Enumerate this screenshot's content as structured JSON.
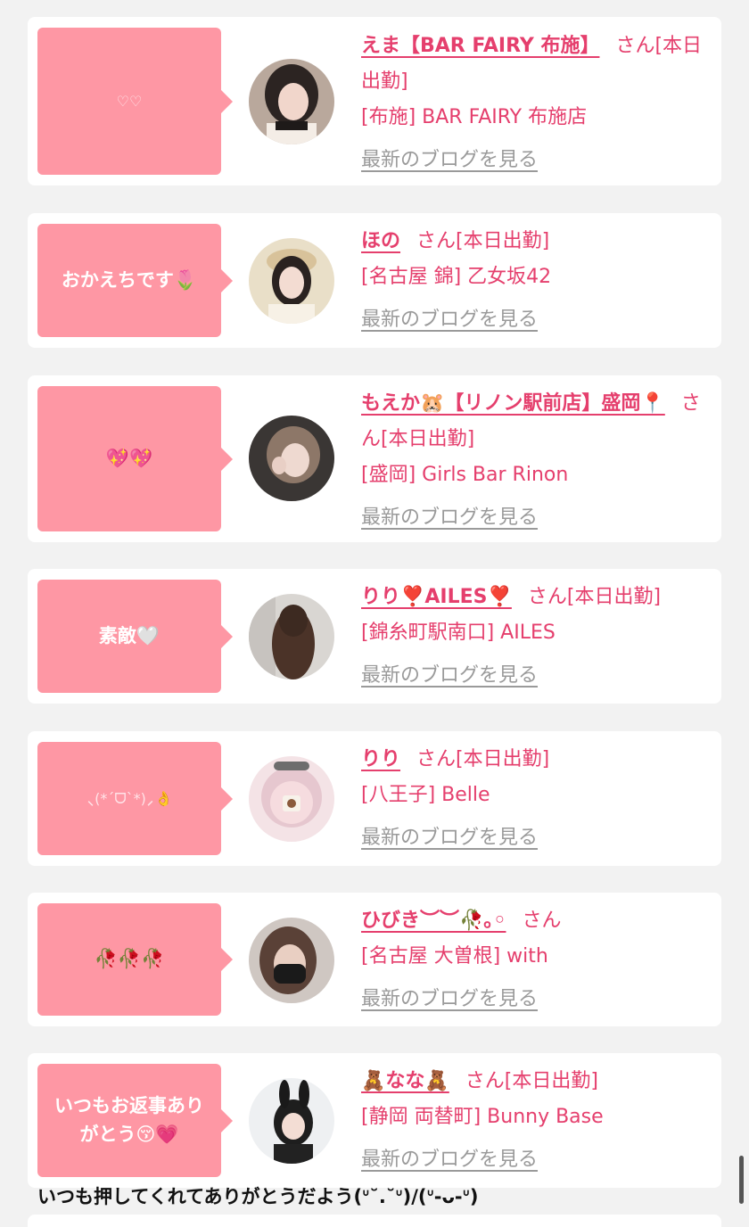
{
  "entries": [
    {
      "comment": "♡♡",
      "name": "えま【BAR FAIRY 布施】",
      "san": "さん[本日出勤]",
      "shop": "[布施] BAR FAIRY 布施店",
      "blog_link": "最新のブログを見る"
    },
    {
      "comment": "おかえちです🌷",
      "name": "ほの",
      "san": "さん[本日出勤]",
      "shop": "[名古屋 錦] 乙女坂42",
      "blog_link": "最新のブログを見る"
    },
    {
      "comment": "💖💖",
      "name": "もえか🐹【リノン駅前店】盛岡📍",
      "san": "さん[本日出勤]",
      "shop": "[盛岡] Girls Bar Rinon",
      "blog_link": "最新のブログを見る"
    },
    {
      "comment": "素敵🤍",
      "name": "りり❣️AILES❣️",
      "san": "さん[本日出勤]",
      "shop": "[錦糸町駅南口] AILES",
      "blog_link": "最新のブログを見る"
    },
    {
      "comment": "⸜(*ˊᗜˋ*)⸝👌",
      "name": "りり",
      "san": "さん[本日出勤]",
      "shop": "[八王子] Belle",
      "blog_link": "最新のブログを見る"
    },
    {
      "comment": "🥀🥀🥀",
      "name": "ひびき︶︶🥀｡◦",
      "san": "さん",
      "shop": "[名古屋 大曽根] with",
      "blog_link": "最新のブログを見る"
    },
    {
      "comment": "いつもお返事ありがとう😚💗",
      "name": "🧸なな🧸",
      "san": "さん[本日出勤]",
      "shop": "[静岡 両替町] Bunny Base",
      "blog_link": "最新のブログを見る"
    }
  ],
  "next_comment": "いつも押してくれてありがとうだよう(ᐡ˘.˘ᐡ)/(ᐡ-ᴗ-ᐡ)",
  "colors": {
    "background": "#f2f2f2",
    "bubble": "#fe97a4",
    "name": "#e53f6d",
    "blog_link": "#9a9a9a"
  },
  "icons": [
    "avatar-photo",
    "speech-bubble-arrow",
    "scrollbar"
  ]
}
